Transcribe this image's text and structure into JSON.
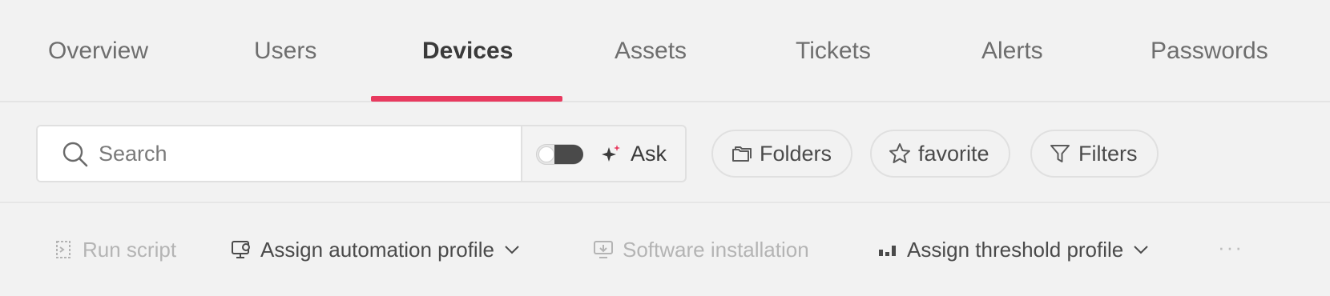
{
  "tabs": [
    {
      "label": "Overview",
      "active": false
    },
    {
      "label": "Users",
      "active": false
    },
    {
      "label": "Devices",
      "active": true
    },
    {
      "label": "Assets",
      "active": false
    },
    {
      "label": "Tickets",
      "active": false
    },
    {
      "label": "Alerts",
      "active": false
    },
    {
      "label": "Passwords",
      "active": false
    }
  ],
  "search": {
    "placeholder": "Search",
    "value": "",
    "ask_label": "Ask",
    "ask_toggle_on": false
  },
  "filters": {
    "folders_label": "Folders",
    "favorite_label": "favorite",
    "filters_label": "Filters"
  },
  "actions": {
    "run_script": {
      "label": "Run script",
      "enabled": false
    },
    "assign_automation_profile": {
      "label": "Assign automation profile",
      "enabled": true
    },
    "software_installation": {
      "label": "Software installation",
      "enabled": false
    },
    "assign_threshold_profile": {
      "label": "Assign threshold profile",
      "enabled": true
    },
    "more": "···"
  },
  "colors": {
    "accent": "#e83a5f",
    "background": "#f2f2f2",
    "disabled_text": "#b4b4b4"
  }
}
